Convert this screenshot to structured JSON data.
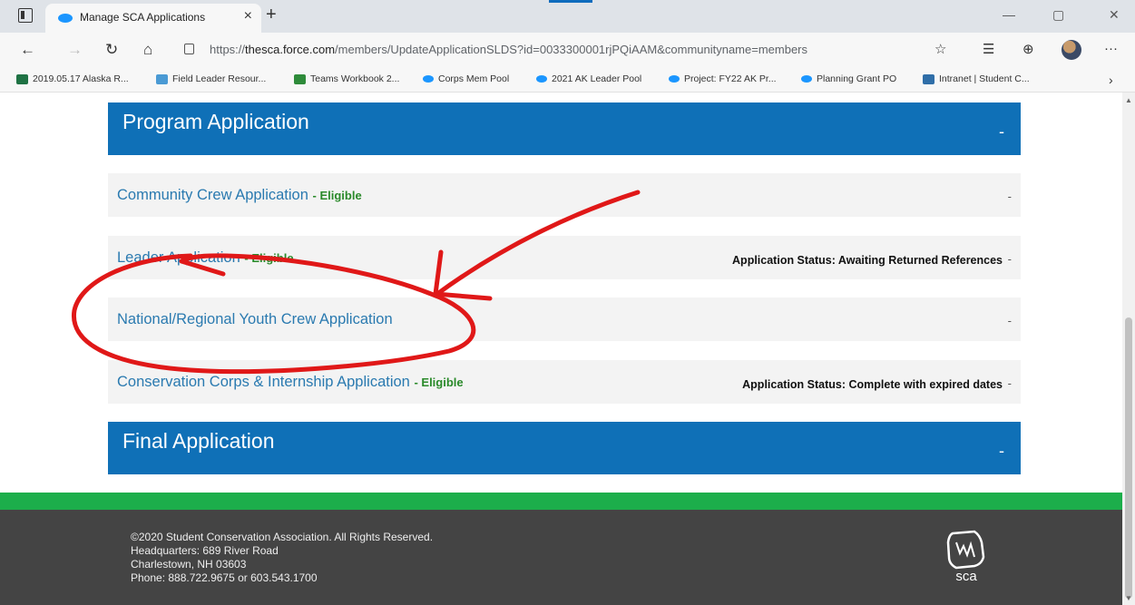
{
  "browser": {
    "tab_title": "Manage SCA Applications",
    "tab_close_glyph": "×",
    "new_tab_glyph": "+",
    "url_prefix": "https://",
    "url_host": "thesca.force.com",
    "url_path": "/members/UpdateApplicationSLDS?id=0033300001rjPQiAAM&communityname=members",
    "window_controls": {
      "minimize": "—",
      "restore": "▢",
      "close": "✕"
    },
    "nav_glyphs": {
      "back": "←",
      "forward": "→",
      "refresh": "↻",
      "home": "⌂"
    },
    "toolbar_glyphs": {
      "favorite": "☆",
      "favorites": "☰",
      "collections": "⊕",
      "more": "···"
    },
    "bookmarks": [
      {
        "label": "2019.05.17 Alaska R...",
        "icon": "excel-icon"
      },
      {
        "label": "Field Leader Resour...",
        "icon": "field-icon"
      },
      {
        "label": "Teams Workbook 2...",
        "icon": "teams-icon"
      },
      {
        "label": "Corps Mem Pool",
        "icon": "salesforce-icon"
      },
      {
        "label": "2021 AK Leader Pool",
        "icon": "salesforce-icon"
      },
      {
        "label": "Project: FY22 AK Pr...",
        "icon": "salesforce-icon"
      },
      {
        "label": "Planning Grant PO",
        "icon": "salesforce-icon"
      },
      {
        "label": "Intranet | Student C...",
        "icon": "intranet-icon"
      }
    ],
    "bookmarks_more_glyph": "›"
  },
  "page": {
    "program_section": {
      "title": "Program Application",
      "toggle": "-"
    },
    "applications": [
      {
        "name": "Community Crew Application",
        "eligibility": "- Eligible",
        "status": "",
        "toggle": "-"
      },
      {
        "name": "Leader Application",
        "eligibility": "- Eligible",
        "status": "Application Status: Awaiting Returned References",
        "toggle": "-"
      },
      {
        "name": "National/Regional Youth Crew Application",
        "eligibility": "",
        "status": "",
        "toggle": "-"
      },
      {
        "name": "Conservation Corps & Internship Application",
        "eligibility": "- Eligible",
        "status": "Application Status: Complete with expired dates",
        "toggle": "-"
      }
    ],
    "final_section": {
      "title": "Final Application",
      "toggle": "-"
    }
  },
  "footer": {
    "copyright": "©2020 Student Conservation Association. All Rights Reserved.",
    "address_line1": "Headquarters: 689 River Road",
    "address_line2": "Charlestown, NH 03603",
    "phone": "Phone: 888.722.9675 or 603.543.1700",
    "logo_text": "sca"
  },
  "colors": {
    "header_blue": "#0f70b7",
    "link_blue": "#2a7ab0",
    "eligible_green": "#2a8a2a",
    "footer_green": "#1cae4b",
    "footer_gray": "#444444",
    "annotation_red": "#e01818"
  }
}
